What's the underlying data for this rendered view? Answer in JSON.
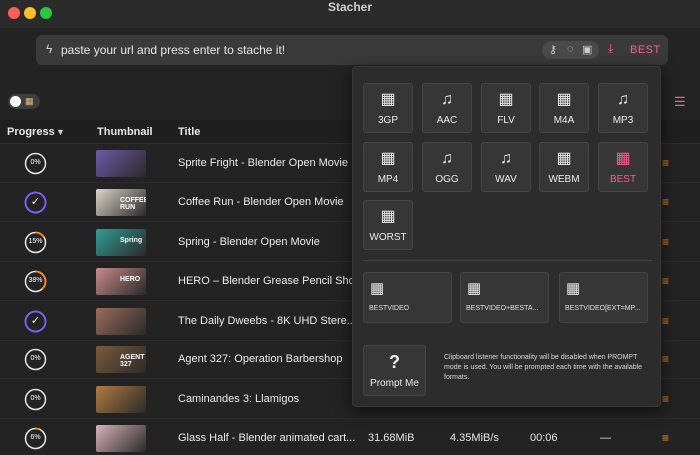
{
  "app": {
    "title": "Stacher"
  },
  "url_bar": {
    "placeholder": "paste your url and press enter to stache it!",
    "format_label": "BEST"
  },
  "colors": {
    "accent": "#ff5c8a",
    "menu": "#ff8c1a",
    "ring_progress": "#ff8c1a",
    "ring_done": "#7b5cff"
  },
  "table": {
    "headers": {
      "progress": "Progress",
      "thumbnail": "Thumbnail",
      "title": "Title"
    },
    "rows": [
      {
        "progress": "0%",
        "done": false,
        "title": "Sprite Fright - Blender Open Movie",
        "thumb_text": "",
        "thumb_color": "#6c5aa8"
      },
      {
        "progress": "",
        "done": true,
        "title": "Coffee Run - Blender Open Movie",
        "thumb_text": "COFFEE RUN",
        "thumb_color": "#dcd6cb"
      },
      {
        "progress": "15%",
        "done": false,
        "title": "Spring - Blender Open Movie",
        "thumb_text": "Spring",
        "thumb_color": "#2f9c94"
      },
      {
        "progress": "38%",
        "done": false,
        "title": "HERO – Blender Grease Pencil Sho...",
        "thumb_text": "HERO",
        "thumb_color": "#c98a8a"
      },
      {
        "progress": "",
        "done": true,
        "title": "The Daily Dweebs - 8K UHD Stere...",
        "thumb_text": "",
        "thumb_color": "#9a6b5c"
      },
      {
        "progress": "0%",
        "done": false,
        "title": "Agent 327: Operation Barbershop",
        "thumb_text": "AGENT 327",
        "thumb_color": "#7a5a3a"
      },
      {
        "progress": "0%",
        "done": false,
        "title": "Caminandes 3: Llamigos",
        "thumb_text": "",
        "thumb_color": "#b07a40"
      },
      {
        "progress": "6%",
        "done": false,
        "title": "Glass Half - Blender animated cart...",
        "thumb_text": "",
        "thumb_color": "#d8b0b8",
        "size": "31.68MiB",
        "speed": "4.35MiB/s",
        "eta": "00:06",
        "extra": "—"
      }
    ]
  },
  "formats": {
    "audio_video": [
      {
        "label": "3GP",
        "icon": "film-icon"
      },
      {
        "label": "AAC",
        "icon": "music-note-icon"
      },
      {
        "label": "FLV",
        "icon": "film-icon"
      },
      {
        "label": "M4A",
        "icon": "film-icon"
      },
      {
        "label": "MP3",
        "icon": "music-note-icon"
      },
      {
        "label": "MP4",
        "icon": "film-icon"
      },
      {
        "label": "OGG",
        "icon": "music-note-icon"
      },
      {
        "label": "WAV",
        "icon": "music-note-icon"
      },
      {
        "label": "WEBM",
        "icon": "film-icon"
      },
      {
        "label": "BEST",
        "icon": "film-icon",
        "selected": true
      },
      {
        "label": "WORST",
        "icon": "film-icon"
      }
    ],
    "video_combos": [
      {
        "label": "BESTVIDEO",
        "icon": "film-icon"
      },
      {
        "label": "BESTVIDEO+BESTA...",
        "icon": "film-icon"
      },
      {
        "label": "BESTVIDEO[EXT=MP...",
        "icon": "film-icon"
      }
    ],
    "prompt": {
      "label": "Prompt Me",
      "icon": "question-icon",
      "note": "Clipboard listener functionality will be disabled when PROMPT mode is used. You will be prompted each time with the available formats."
    }
  }
}
